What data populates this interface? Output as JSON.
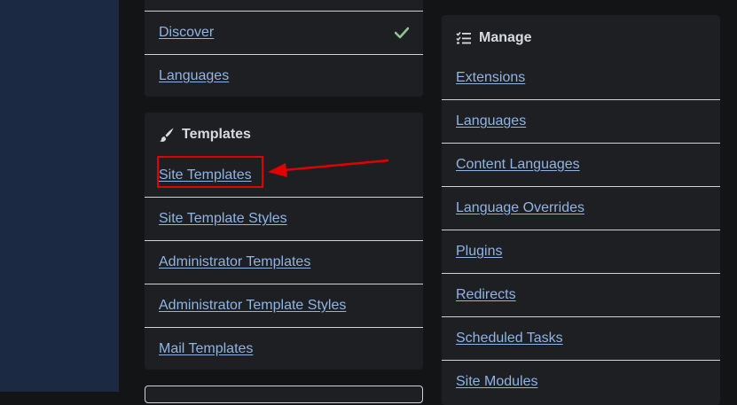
{
  "discover_card": {
    "items": [
      {
        "label": "Discover",
        "status": "check-icon"
      },
      {
        "label": "Languages"
      }
    ]
  },
  "templates_card": {
    "title": "Templates",
    "icon": "brush-icon",
    "items": [
      {
        "label": "Site Templates"
      },
      {
        "label": "Site Template Styles"
      },
      {
        "label": "Administrator Templates"
      },
      {
        "label": "Administrator Template Styles"
      },
      {
        "label": "Mail Templates"
      }
    ]
  },
  "manage_card": {
    "title": "Manage",
    "icon": "list-check-icon",
    "items": [
      {
        "label": "Extensions"
      },
      {
        "label": "Languages"
      },
      {
        "label": "Content Languages"
      },
      {
        "label": "Language Overrides"
      },
      {
        "label": "Plugins"
      },
      {
        "label": "Redirects"
      },
      {
        "label": "Scheduled Tasks"
      },
      {
        "label": "Site Modules"
      }
    ]
  },
  "annotation": {
    "color": "#e10000",
    "target": "Site Templates"
  },
  "colors": {
    "link": "#8fb4e6",
    "check": "#8fc491",
    "card": "#1e1f22",
    "sidebar": "#1b2a42"
  }
}
